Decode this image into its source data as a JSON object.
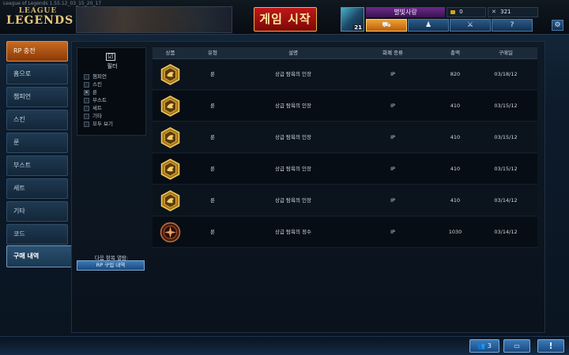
{
  "window": {
    "title": "League of Legends 1.55.12_03_15_20_17"
  },
  "logo": {
    "line1": "LEAGUE",
    "line2": "LEGENDS"
  },
  "header": {
    "play_label": "게임 시작",
    "summoner_name": "별빛사랑",
    "level": "21",
    "rp": "0",
    "ip": "321",
    "nav": [
      {
        "label": "⛟",
        "name": "store"
      },
      {
        "label": "♟",
        "name": "profile"
      },
      {
        "label": "⚔",
        "name": "champions"
      },
      {
        "label": "?",
        "name": "help"
      }
    ],
    "settings_icon": "⚙"
  },
  "sidebar": {
    "items": [
      {
        "label": "RP 충전"
      },
      {
        "label": "홈으로"
      },
      {
        "label": "챔피언"
      },
      {
        "label": "스킨"
      },
      {
        "label": "룬"
      },
      {
        "label": "부스트"
      },
      {
        "label": "세트"
      },
      {
        "label": "기타"
      },
      {
        "label": "코드"
      },
      {
        "label": "구매 내역"
      }
    ]
  },
  "filter": {
    "title": "필터",
    "icon": "☑",
    "options": [
      {
        "label": "챔피언",
        "checked": false
      },
      {
        "label": "스킨",
        "checked": false
      },
      {
        "label": "룬",
        "checked": true
      },
      {
        "label": "부스트",
        "checked": false
      },
      {
        "label": "세트",
        "checked": false
      },
      {
        "label": "기타",
        "checked": false
      },
      {
        "label": "모두 보기",
        "checked": false
      }
    ]
  },
  "next": {
    "label": "다음 항목 열람:",
    "button": "RP 구입 내역"
  },
  "table": {
    "headers": [
      "상품",
      "유형",
      "설명",
      "화폐 종류",
      "총액",
      "구매일"
    ],
    "rows": [
      {
        "icon": "mark",
        "type": "룬",
        "desc": "상급 탐욕의 인장",
        "currency": "IP",
        "total": "820",
        "date": "03/18/12"
      },
      {
        "icon": "mark",
        "type": "룬",
        "desc": "상급 탐욕의 인장",
        "currency": "IP",
        "total": "410",
        "date": "03/15/12"
      },
      {
        "icon": "mark",
        "type": "룬",
        "desc": "상급 탐욕의 인장",
        "currency": "IP",
        "total": "410",
        "date": "03/15/12"
      },
      {
        "icon": "mark",
        "type": "룬",
        "desc": "상급 탐욕의 인장",
        "currency": "IP",
        "total": "410",
        "date": "03/15/12"
      },
      {
        "icon": "mark",
        "type": "룬",
        "desc": "상급 탐욕의 인장",
        "currency": "IP",
        "total": "410",
        "date": "03/14/12"
      },
      {
        "icon": "quint",
        "type": "룬",
        "desc": "상급 탐욕의 정수",
        "currency": "IP",
        "total": "1030",
        "date": "03/14/12"
      }
    ]
  },
  "bottom": {
    "friends_count": "3",
    "friends_icon": "👥",
    "chat_icon": "▭",
    "notify_icon": "!"
  },
  "colors": {
    "accent_gold": "#e2b850",
    "play_red": "#c01818",
    "nav_blue": "#2a5a8a",
    "store_orange": "#f0a030"
  }
}
